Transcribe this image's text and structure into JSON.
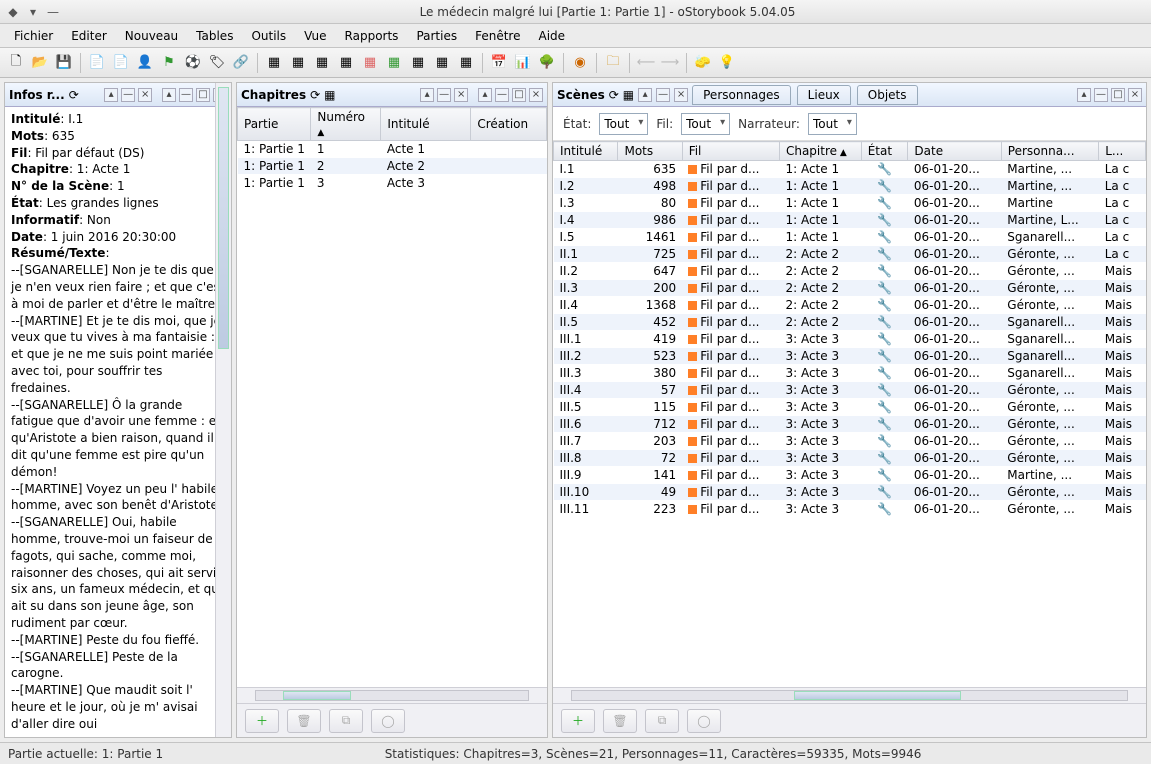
{
  "window": {
    "title": "Le médecin malgré lui [Partie 1: Partie 1] - oStorybook 5.04.05"
  },
  "menu": [
    "Fichier",
    "Editer",
    "Nouveau",
    "Tables",
    "Outils",
    "Vue",
    "Rapports",
    "Parties",
    "Fenêtre",
    "Aide"
  ],
  "info": {
    "title": "Infos r...",
    "fields": {
      "intitule_k": "Intitulé",
      "intitule_v": "I.1",
      "mots_k": "Mots",
      "mots_v": "635",
      "fil_k": "Fil",
      "fil_v": "Fil par défaut (DS)",
      "chapitre_k": "Chapitre",
      "chapitre_v": "1: Acte 1",
      "nscene_k": "N° de la Scène",
      "nscene_v": "1",
      "etat_k": "État",
      "etat_v": "Les grandes lignes",
      "informatif_k": "Informatif",
      "informatif_v": "Non",
      "date_k": "Date",
      "date_v": "1 juin 2016 20:30:00",
      "resume_k": "Résumé/Texte"
    },
    "text": "--[SGANARELLE] Non je te dis que je n'en veux rien faire ; et que c'est à moi de parler et d'être le maître.\n--[MARTINE] Et je te dis moi, que je veux que tu vives à ma fantaisie : et que je ne me suis point mariée avec toi, pour souffrir tes fredaines.\n--[SGANARELLE] Ô la grande fatigue que d'avoir une femme : et qu'Aristote a bien raison, quand il dit qu'une femme est pire qu'un démon!\n--[MARTINE] Voyez un peu l' habile homme, avec son benêt d'Aristote.\n--[SGANARELLE] Oui, habile homme, trouve-moi un faiseur de fagots, qui sache, comme moi, raisonner des choses, qui ait servi six ans, un fameux médecin, et qui ait su dans son jeune âge, son rudiment par cœur.\n--[MARTINE] Peste du fou fieffé.\n--[SGANARELLE] Peste de la carogne.\n--[MARTINE] Que maudit soit l' heure et le jour, où je m' avisai d'aller dire oui"
  },
  "chapitres": {
    "title": "Chapitres",
    "cols": [
      "Partie",
      "Numéro",
      "Intitulé",
      "Création"
    ],
    "rows": [
      {
        "partie": "1: Partie 1",
        "num": "1",
        "intitule": "Acte 1"
      },
      {
        "partie": "1: Partie 1",
        "num": "2",
        "intitule": "Acte 2"
      },
      {
        "partie": "1: Partie 1",
        "num": "3",
        "intitule": "Acte 3"
      }
    ]
  },
  "scenes": {
    "title": "Scènes",
    "tabs": [
      "Scènes",
      "Personnages",
      "Lieux",
      "Objets"
    ],
    "filters": {
      "etat_label": "État:",
      "etat_val": "Tout",
      "fil_label": "Fil:",
      "fil_val": "Tout",
      "narr_label": "Narrateur:",
      "narr_val": "Tout"
    },
    "cols": [
      "Intitulé",
      "Mots",
      "Fil",
      "Chapitre",
      "État",
      "Date",
      "Personna...",
      "L..."
    ],
    "rows": [
      {
        "i": "I.1",
        "m": "635",
        "f": "Fil par d...",
        "c": "1: Acte 1",
        "d": "06-01-20...",
        "p": "Martine, ...",
        "l": "La c"
      },
      {
        "i": "I.2",
        "m": "498",
        "f": "Fil par d...",
        "c": "1: Acte 1",
        "d": "06-01-20...",
        "p": "Martine, ...",
        "l": "La c"
      },
      {
        "i": "I.3",
        "m": "80",
        "f": "Fil par d...",
        "c": "1: Acte 1",
        "d": "06-01-20...",
        "p": "Martine",
        "l": "La c"
      },
      {
        "i": "I.4",
        "m": "986",
        "f": "Fil par d...",
        "c": "1: Acte 1",
        "d": "06-01-20...",
        "p": "Martine, L...",
        "l": "La c"
      },
      {
        "i": "I.5",
        "m": "1461",
        "f": "Fil par d...",
        "c": "1: Acte 1",
        "d": "06-01-20...",
        "p": "Sganarell...",
        "l": "La c"
      },
      {
        "i": "II.1",
        "m": "725",
        "f": "Fil par d...",
        "c": "2: Acte 2",
        "d": "06-01-20...",
        "p": "Géronte, ...",
        "l": "La c"
      },
      {
        "i": "II.2",
        "m": "647",
        "f": "Fil par d...",
        "c": "2: Acte 2",
        "d": "06-01-20...",
        "p": "Géronte, ...",
        "l": "Mais"
      },
      {
        "i": "II.3",
        "m": "200",
        "f": "Fil par d...",
        "c": "2: Acte 2",
        "d": "06-01-20...",
        "p": "Géronte, ...",
        "l": "Mais"
      },
      {
        "i": "II.4",
        "m": "1368",
        "f": "Fil par d...",
        "c": "2: Acte 2",
        "d": "06-01-20...",
        "p": "Géronte, ...",
        "l": "Mais"
      },
      {
        "i": "II.5",
        "m": "452",
        "f": "Fil par d...",
        "c": "2: Acte 2",
        "d": "06-01-20...",
        "p": "Sganarell...",
        "l": "Mais"
      },
      {
        "i": "III.1",
        "m": "419",
        "f": "Fil par d...",
        "c": "3: Acte 3",
        "d": "06-01-20...",
        "p": "Sganarell...",
        "l": "Mais"
      },
      {
        "i": "III.2",
        "m": "523",
        "f": "Fil par d...",
        "c": "3: Acte 3",
        "d": "06-01-20...",
        "p": "Sganarell...",
        "l": "Mais"
      },
      {
        "i": "III.3",
        "m": "380",
        "f": "Fil par d...",
        "c": "3: Acte 3",
        "d": "06-01-20...",
        "p": "Sganarell...",
        "l": "Mais"
      },
      {
        "i": "III.4",
        "m": "57",
        "f": "Fil par d...",
        "c": "3: Acte 3",
        "d": "06-01-20...",
        "p": "Géronte, ...",
        "l": "Mais"
      },
      {
        "i": "III.5",
        "m": "115",
        "f": "Fil par d...",
        "c": "3: Acte 3",
        "d": "06-01-20...",
        "p": "Géronte, ...",
        "l": "Mais"
      },
      {
        "i": "III.6",
        "m": "712",
        "f": "Fil par d...",
        "c": "3: Acte 3",
        "d": "06-01-20...",
        "p": "Géronte, ...",
        "l": "Mais"
      },
      {
        "i": "III.7",
        "m": "203",
        "f": "Fil par d...",
        "c": "3: Acte 3",
        "d": "06-01-20...",
        "p": "Géronte, ...",
        "l": "Mais"
      },
      {
        "i": "III.8",
        "m": "72",
        "f": "Fil par d...",
        "c": "3: Acte 3",
        "d": "06-01-20...",
        "p": "Géronte, ...",
        "l": "Mais"
      },
      {
        "i": "III.9",
        "m": "141",
        "f": "Fil par d...",
        "c": "3: Acte 3",
        "d": "06-01-20...",
        "p": "Martine, ...",
        "l": "Mais"
      },
      {
        "i": "III.10",
        "m": "49",
        "f": "Fil par d...",
        "c": "3: Acte 3",
        "d": "06-01-20...",
        "p": "Géronte, ...",
        "l": "Mais"
      },
      {
        "i": "III.11",
        "m": "223",
        "f": "Fil par d...",
        "c": "3: Acte 3",
        "d": "06-01-20...",
        "p": "Géronte, ...",
        "l": "Mais"
      }
    ]
  },
  "status": {
    "left": "Partie actuelle: 1: Partie 1",
    "right": "Statistiques: Chapitres=3,  Scènes=21,  Personnages=11,  Caractères=59335,  Mots=9946"
  }
}
